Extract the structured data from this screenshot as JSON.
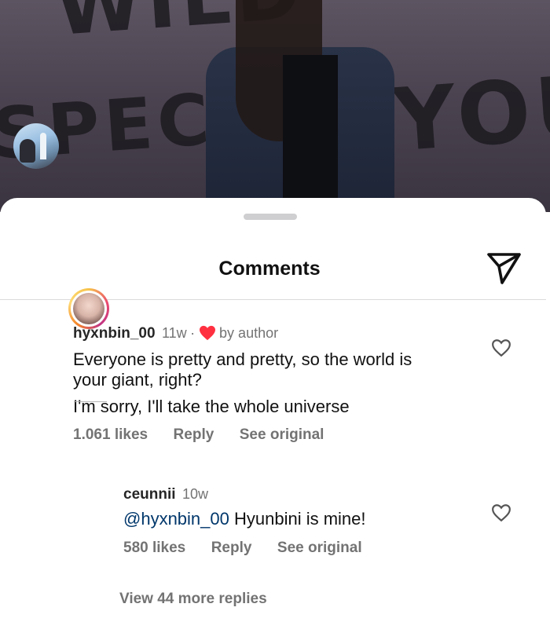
{
  "background": {
    "graffiti": [
      "WILD",
      "SPECI",
      "YOU"
    ]
  },
  "sheet": {
    "title": "Comments"
  },
  "comments": [
    {
      "username": "hyxnbin_00",
      "time": "11w",
      "separator": "·",
      "badge": "by author",
      "text_lines": [
        "Everyone is pretty and pretty, so the world is",
        "your giant, right?",
        "I'm sorry, I'll take the whole universe"
      ],
      "likes": "1.061 likes",
      "reply_label": "Reply",
      "see_original_label": "See original"
    },
    {
      "username": "ceunnii",
      "time": "10w",
      "mention": "@hyxnbin_00",
      "text": " Hyunbini is mine!",
      "likes": "580 likes",
      "reply_label": "Reply",
      "see_original_label": "See original"
    }
  ],
  "view_more": "View 44 more replies",
  "colors": {
    "heart": "#ff3040",
    "mention": "#00376b",
    "secondary": "#737373"
  }
}
